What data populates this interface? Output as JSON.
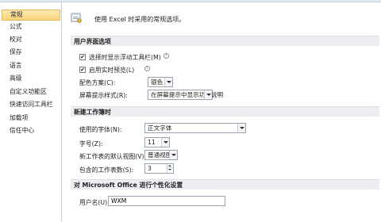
{
  "sidebar": {
    "items": [
      {
        "label": "常规",
        "selected": true
      },
      {
        "label": "公式"
      },
      {
        "label": "校对"
      },
      {
        "label": "保存"
      },
      {
        "label": "语言"
      },
      {
        "label": "高级"
      },
      {
        "label": "自定义功能区"
      },
      {
        "label": "快速访问工具栏"
      },
      {
        "label": "加载项"
      },
      {
        "label": "信任中心"
      }
    ]
  },
  "intro": {
    "text": "使用 Excel 时采用的常规选项。"
  },
  "ui_section": {
    "title": "用户界面选项",
    "mini_toolbar_label": "选择时显示浮动工具栏(M)",
    "mini_toolbar_checked": true,
    "live_preview_label": "启用实时预览(L)",
    "live_preview_checked": true,
    "color_scheme_label": "配色方案(C):",
    "color_scheme_value": "银色",
    "screentip_label": "屏幕提示样式(R):",
    "screentip_value": "在屏幕提示中显示功能说明",
    "info_glyph": "i"
  },
  "new_workbook": {
    "title": "新建工作簿时",
    "font_label": "使用的字体(N):",
    "font_value": "正文字体",
    "size_label": "字号(Z):",
    "size_value": "11",
    "view_label": "新工作表的默认视图(V):",
    "view_value": "普通视图",
    "sheets_label": "包含的工作表数(S):",
    "sheets_value": "3"
  },
  "personalize": {
    "title": "对 Microsoft Office 进行个性化设置",
    "username_label": "用户名(U):",
    "username_value": "WXM"
  },
  "check_glyph": "✔"
}
